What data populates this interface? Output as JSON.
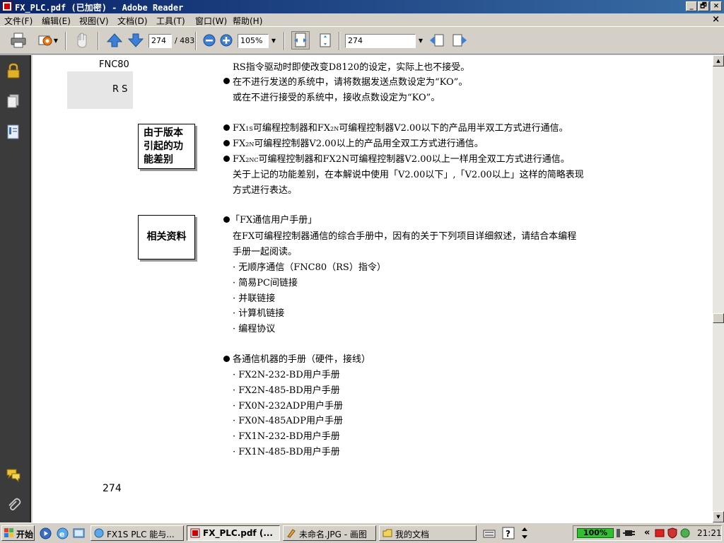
{
  "window": {
    "title": "FX_PLC.pdf (已加密) - Adobe Reader",
    "min_label": "_",
    "restore_label": "🗗",
    "close_label": "×"
  },
  "menu": {
    "items": [
      "文件(F)",
      "编辑(E)",
      "视图(V)",
      "文档(D)",
      "工具(T)",
      "窗口(W)",
      "帮助(H)"
    ],
    "doc_close": "×"
  },
  "toolbar": {
    "page_current": "274",
    "page_total": "/ 483",
    "zoom": "105%",
    "search_value": "274"
  },
  "document": {
    "left_label_1": "FNC80",
    "left_label_2": "R S",
    "line_1": "RS指令驱动时即使改变D8120的设定，实际上也不接受。",
    "line_2": "在不进行发送的系统中，请将数据发送点数设定为“KO”。",
    "line_3": "或在不进行接受的系统中，接收点数设定为“KO”。",
    "box_1": [
      "由于版本",
      "引起的功",
      "能差别"
    ],
    "v_line_1": "FX1S可编程控制器和FX2N可编程控制器V2.00以下的产品用半双工方式进行通信。",
    "v_line_2": "FX2N可编程控制器V2.00以上的产品用全双工方式进行通信。",
    "v_line_3": "FX2NC可编程控制器和FX2N可编程控制器V2.00以上一样用全双工方式进行通信。",
    "v_line_4": "关于上记的功能差别，在本解说中使用「V2.00以下」,「V2.00以上」这样的简略表现",
    "v_line_5": "方式进行表达。",
    "box_2": "相关资料",
    "ref_1": "「FX通信用户手册」",
    "ref_2": "在FX可编程控制器通信的综合手册中，因有的关于下列项目详细叙述，请结合本编程",
    "ref_3": "手册一起阅读。",
    "ref_items": [
      "· 无顺序通信（FNC80（RS）指令）",
      "· 简易PC间链接",
      "· 并联链接",
      "· 计算机链接",
      "· 编程协议"
    ],
    "manual_title": "各通信机器的手册（硬件，接线）",
    "manual_items": [
      "· FX2N-232-BD用户手册",
      "· FX2N-485-BD用户手册",
      "· FX0N-232ADP用户手册",
      "· FX0N-485ADP用户手册",
      "· FX1N-232-BD用户手册",
      "· FX1N-485-BD用户手册"
    ],
    "page_number": "274"
  },
  "taskbar": {
    "start": "开始",
    "tasks": [
      "FX1S PLC 能与...",
      "FX_PLC.pdf (...",
      "未命名.JPG - 画图",
      "我的文档"
    ],
    "battery": "100%",
    "tray_expand": "«",
    "clock": "21:21"
  }
}
